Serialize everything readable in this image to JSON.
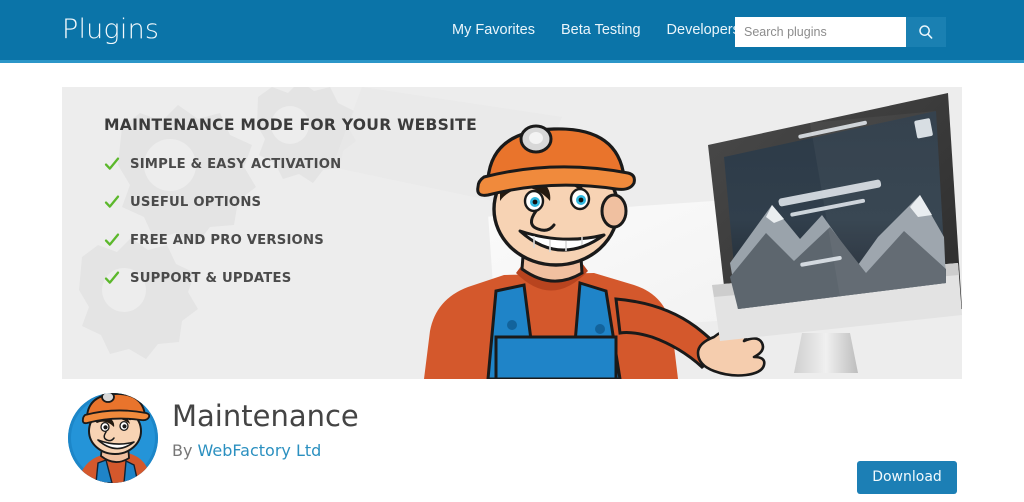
{
  "header": {
    "site_title": "Plugins",
    "nav": [
      {
        "label": "My Favorites",
        "name": "nav-my-favorites"
      },
      {
        "label": "Beta Testing",
        "name": "nav-beta-testing"
      },
      {
        "label": "Developers",
        "name": "nav-developers"
      }
    ],
    "search": {
      "placeholder": "Search plugins",
      "value": "",
      "submit_icon": "search-icon"
    },
    "background_color": "#0b74a8",
    "accent_border_color": "#2b96c8"
  },
  "banner": {
    "heading": "MAINTENANCE MODE FOR YOUR WEBSITE",
    "features": [
      "SIMPLE & EASY ACTIVATION",
      "USEFUL OPTIONS",
      "FREE AND PRO VERSIONS",
      "SUPPORT & UPDATES"
    ],
    "check_color": "#5cb82c",
    "background_color": "#ededed",
    "illustrations": [
      "miner-character-illustration",
      "desktop-monitor-illustration"
    ]
  },
  "plugin": {
    "icon": "maintenance-plugin-icon",
    "name": "Maintenance",
    "by_prefix": "By ",
    "author": "WebFactory Ltd",
    "download_label": "Download",
    "download_color": "#1c7fb5",
    "author_link_color": "#2b90c0"
  }
}
